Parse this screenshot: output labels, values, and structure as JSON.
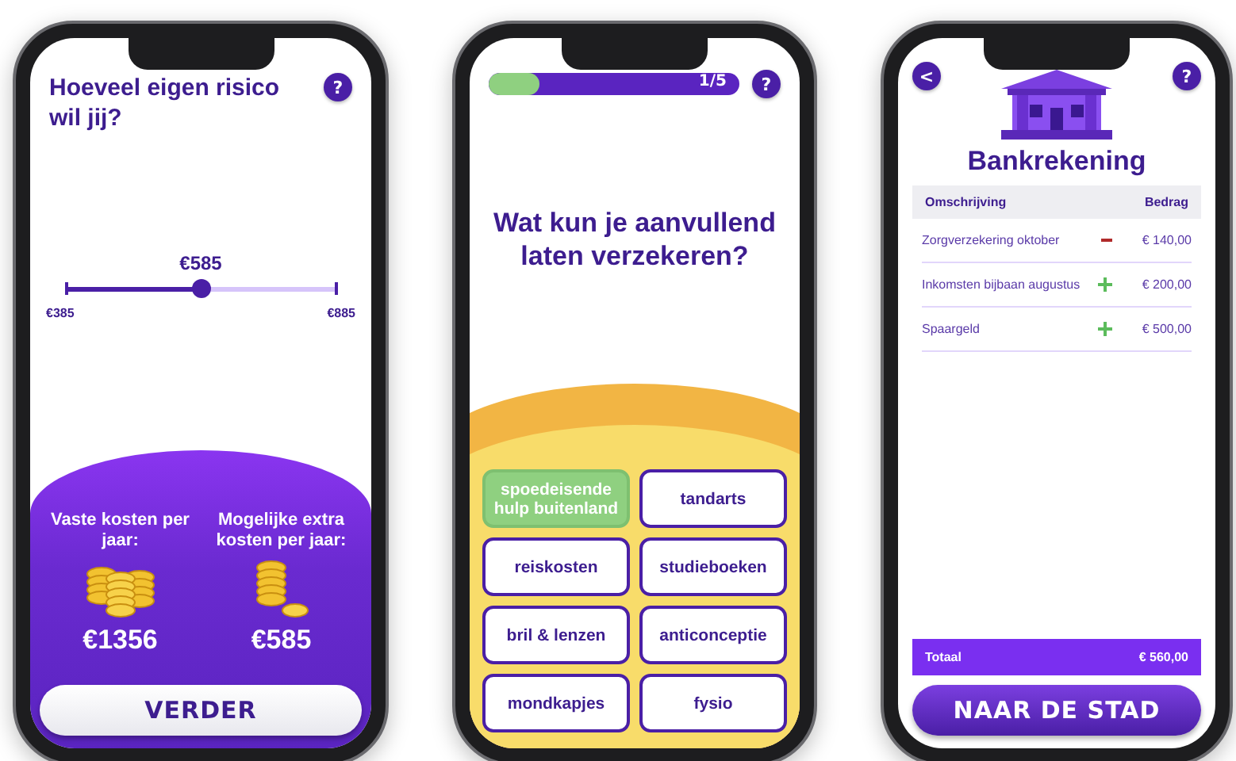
{
  "slider_screen": {
    "title": "Hoeveel eigen risico wil jij?",
    "help": "?",
    "slider": {
      "value": "€585",
      "min": "€385",
      "max": "€885",
      "level": 0.5
    },
    "costs": [
      {
        "kind": "stack",
        "label": "Vaste kosten per jaar:",
        "amount": "€1356"
      },
      {
        "kind": "few",
        "label": "Mogelijke extra kosten per jaar:",
        "amount": "€585"
      }
    ],
    "button": "VERDER"
  },
  "quiz_screen": {
    "progress": {
      "level": 0.2,
      "label": "1/5"
    },
    "help": "?",
    "question": "Wat kun je aanvullend laten verzekeren?",
    "options": [
      {
        "label": "spoedeisende hulp buitenland",
        "selected": true
      },
      {
        "label": "tandarts",
        "selected": false
      },
      {
        "label": "reiskosten",
        "selected": false
      },
      {
        "label": "studieboeken",
        "selected": false
      },
      {
        "label": "bril & lenzen",
        "selected": false
      },
      {
        "label": "anticonceptie",
        "selected": false
      },
      {
        "label": "mondkapjes",
        "selected": false
      },
      {
        "label": "fysio",
        "selected": false
      }
    ]
  },
  "bank_screen": {
    "back": "<",
    "help": "?",
    "title": "Bankrekening",
    "columns": [
      "Omschrijving",
      "Bedrag"
    ],
    "rows": [
      {
        "description": "Zorgverzekering oktober",
        "kind": "minus",
        "amount": "€ 140,00"
      },
      {
        "description": "Inkomsten bijbaan augustus",
        "kind": "plus",
        "amount": "€ 200,00"
      },
      {
        "description": "Spaargeld",
        "kind": "plus",
        "amount": "€ 500,00"
      }
    ],
    "total": {
      "label": "Totaal",
      "amount": "€ 560,00"
    },
    "button": "NAAR DE STAD"
  }
}
